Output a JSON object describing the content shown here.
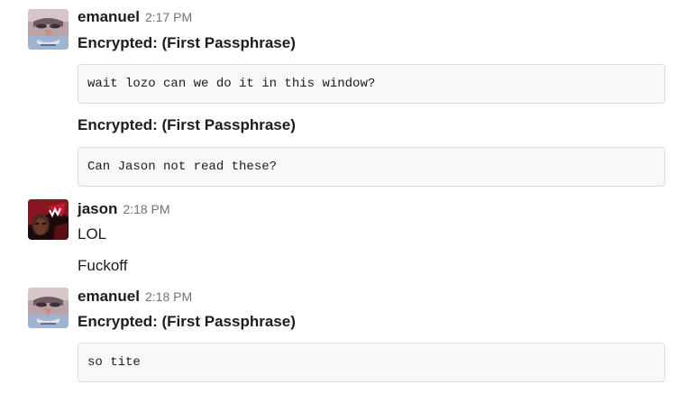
{
  "messages": [
    {
      "user": "emanuel",
      "time": "2:17 PM",
      "avatar_icon": "emanuel-avatar-image",
      "items": [
        {
          "title": "Encrypted: (First Passphrase)",
          "code": "wait lozo can we do it in this window?"
        },
        {
          "title": "Encrypted: (First Passphrase)",
          "code": "Can Jason not read these?"
        }
      ]
    },
    {
      "user": "jason",
      "time": "2:18 PM",
      "avatar_icon": "jason-avatar-image",
      "lines": [
        "LOL",
        "Fuckoff"
      ]
    },
    {
      "user": "emanuel",
      "time": "2:18 PM",
      "avatar_icon": "emanuel-avatar-image",
      "items": [
        {
          "title": "Encrypted: (First Passphrase)",
          "code": "so tite"
        }
      ]
    }
  ],
  "colors": {
    "text": "#1d1c1d",
    "timestamp": "#717274",
    "code_bg": "#f8f8f8",
    "code_border": "#dddddd"
  }
}
